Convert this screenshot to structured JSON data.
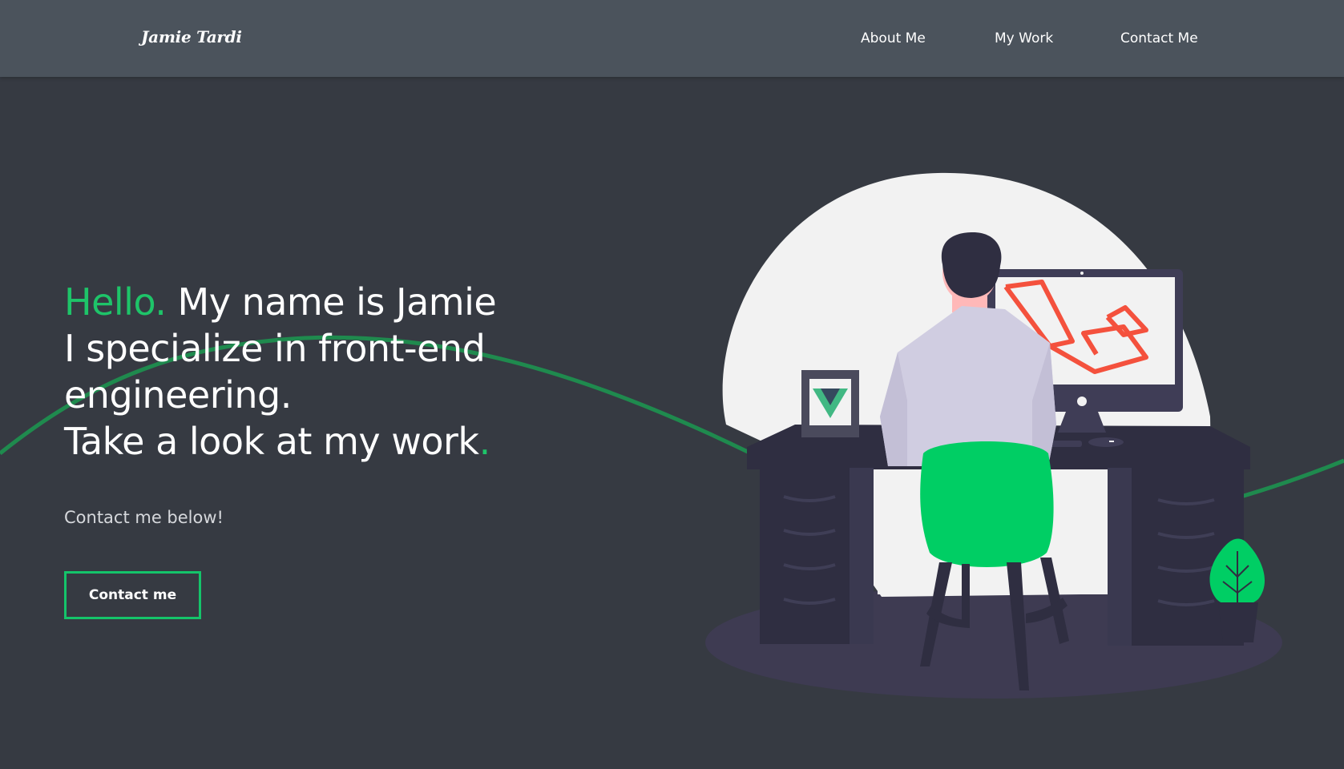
{
  "navbar": {
    "brand": "Jamie Tardi",
    "links": [
      {
        "label": "About Me"
      },
      {
        "label": "My Work"
      },
      {
        "label": "Contact Me"
      }
    ]
  },
  "hero": {
    "hello": "Hello.",
    "line1_rest": " My name is Jamie",
    "line2": "I specialize in front-end engineering.",
    "line3": "Take a look at my work",
    "period": ".",
    "subtext": "Contact me below!",
    "button_label": "Contact me"
  },
  "colors": {
    "accent": "#1ec469",
    "background": "#363a42",
    "navbar": "#4b535c",
    "chair": "#00ce64",
    "laravel_logo": "#f4513d"
  },
  "illustration": {
    "icons": [
      "vue-logo-icon",
      "laravel-logo-icon",
      "plant-icon"
    ]
  }
}
